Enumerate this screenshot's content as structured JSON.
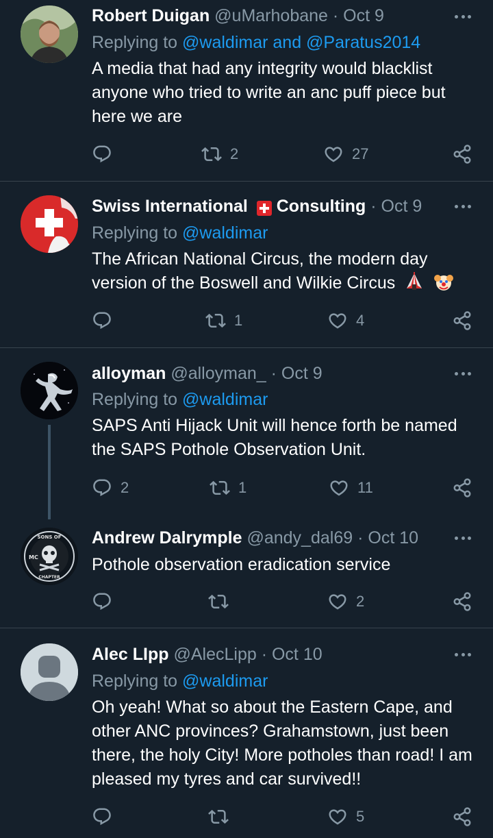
{
  "tweets": [
    {
      "name": "Robert Duigan",
      "handle": "@uMarhobane",
      "separator": "·",
      "date": "Oct 9",
      "replying_prefix": "Replying to",
      "replying_mentions": "@waldimar and @Paratus2014",
      "text": "A media that had any integrity would blacklist anyone who tried to write an anc puff piece but here we are",
      "reply_count": "",
      "retweet_count": "2",
      "like_count": "27",
      "avatar_icon": "person-photo-avatar"
    },
    {
      "name": "Swiss International",
      "name_suffix": "Consulting",
      "separator": "·",
      "date": "Oct 9",
      "replying_prefix": "Replying to",
      "replying_mentions": "@waldimar",
      "text": "The African National Circus, the modern day version of the Boswell and Wilkie Circus",
      "reply_count": "",
      "retweet_count": "1",
      "like_count": "4",
      "avatar_icon": "swiss-cross-avatar",
      "emojis": [
        "circus-tent-emoji",
        "clown-face-emoji"
      ]
    },
    {
      "name": "alloyman",
      "handle": "@alloyman_",
      "separator": "·",
      "date": "Oct 9",
      "replying_prefix": "Replying to",
      "replying_mentions": "@waldimar",
      "text": "SAPS Anti Hijack Unit will hence forth be named the SAPS Pothole Observation Unit.",
      "reply_count": "2",
      "retweet_count": "1",
      "like_count": "11",
      "avatar_icon": "silver-figure-avatar"
    },
    {
      "name": "Andrew Dalrymple",
      "handle": "@andy_dal69",
      "separator": "·",
      "date": "Oct 10",
      "text": "Pothole observation eradication service",
      "reply_count": "",
      "retweet_count": "",
      "like_count": "2",
      "avatar_icon": "skull-badge-avatar"
    },
    {
      "name": "Alec LIpp",
      "handle": "@AlecLipp",
      "separator": "·",
      "date": "Oct 10",
      "replying_prefix": "Replying to",
      "replying_mentions": "@waldimar",
      "text": "Oh yeah! What so about the Eastern Cape, and other ANC provinces? Grahamstown, just been there, the holy City! More potholes than road! I am pleased my tyres and car survived!!",
      "reply_count": "",
      "retweet_count": "",
      "like_count": "5",
      "avatar_icon": "default-profile-avatar"
    }
  ],
  "colors": {
    "background": "#15202b",
    "divider": "#38444d",
    "secondary_text": "#8899a6",
    "link": "#1d9bf0",
    "primary_text": "#ffffff"
  }
}
